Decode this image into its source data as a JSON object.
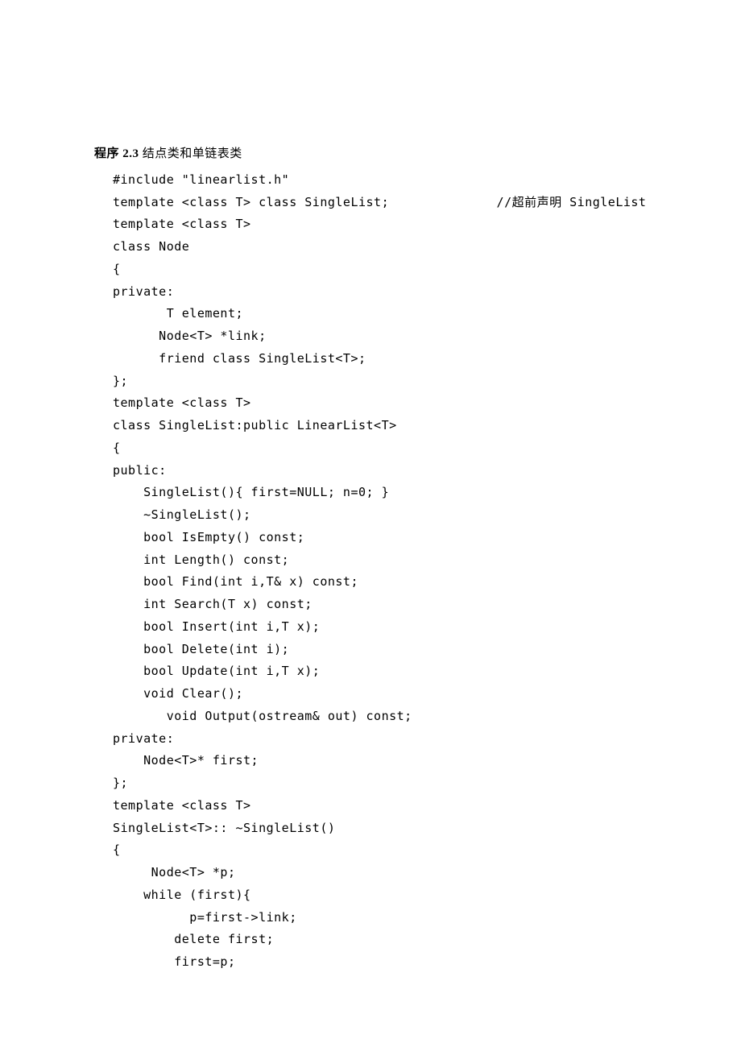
{
  "heading": {
    "label_bold": "程序 2.3",
    "label_rest": "  结点类和单链表类"
  },
  "code_lines": [
    "#include \"linearlist.h\"",
    "template <class T> class SingleList;              //超前声明 SingleList",
    "template <class T>",
    "class Node",
    "{",
    "private:",
    "       T element;",
    "      Node<T> *link;",
    "      friend class SingleList<T>;",
    "};",
    "template <class T>",
    "class SingleList:public LinearList<T>",
    "{",
    "public:",
    "    SingleList(){ first=NULL; n=0; }",
    "    ~SingleList();",
    "    bool IsEmpty() const;",
    "    int Length() const;",
    "    bool Find(int i,T& x) const;",
    "    int Search(T x) const;",
    "    bool Insert(int i,T x);",
    "    bool Delete(int i);",
    "    bool Update(int i,T x);",
    "    void Clear();",
    "       void Output(ostream& out) const;",
    "private:",
    "    Node<T>* first;",
    "};",
    "template <class T>",
    "SingleList<T>:: ~SingleList()",
    "{",
    "     Node<T> *p;",
    "    while (first){",
    "          p=first->link;",
    "        delete first;",
    "        first=p;"
  ]
}
